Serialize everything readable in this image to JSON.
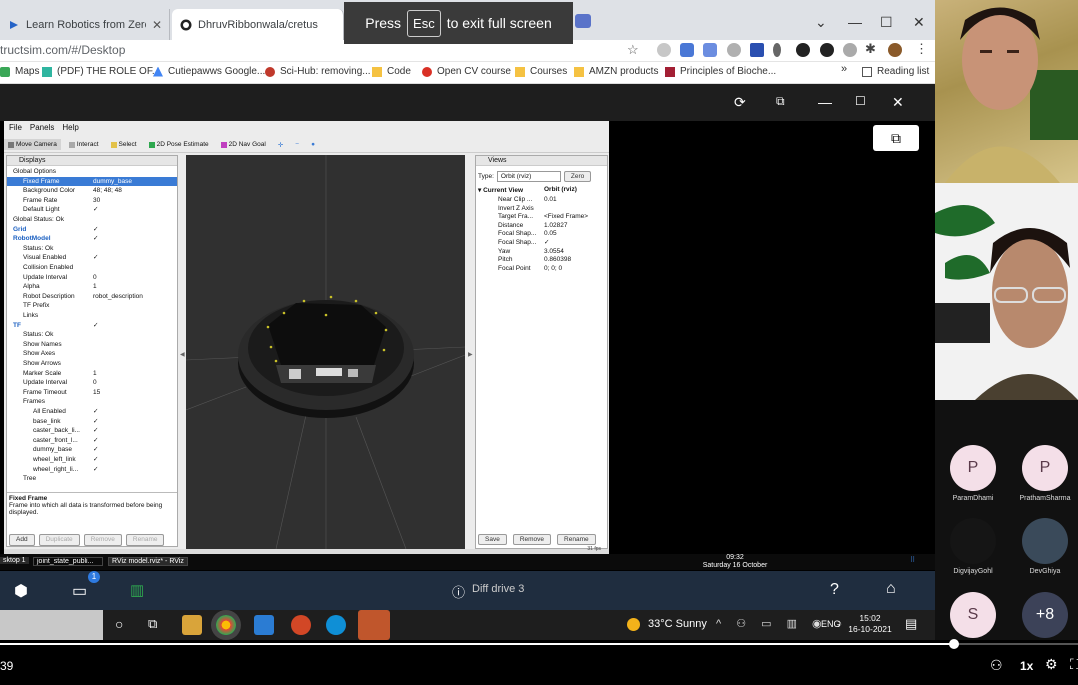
{
  "browser": {
    "tabs": [
      {
        "title": "Learn Robotics from Zero - Robc",
        "active": false
      },
      {
        "title": "DhruvRibbonwala/cretus: A basic",
        "active": true
      }
    ],
    "url": "tructsim.com/#/Desktop",
    "fullscreen_banner": {
      "press": "Press",
      "key": "Esc",
      "rest": "to exit full screen"
    },
    "bookmarks": [
      "Maps",
      "(PDF) THE ROLE OF...",
      "Cutiepawws Google...",
      "Sci-Hub: removing...",
      "Code",
      "Open CV course",
      "Courses",
      "AMZN products",
      "Principles of Bioche..."
    ],
    "bookmarks_more": "»",
    "reading_list": "Reading list"
  },
  "rviz": {
    "menu": [
      "File",
      "Panels",
      "Help"
    ],
    "tools": [
      "Move Camera",
      "Interact",
      "Select",
      "2D Pose Estimate",
      "2D Nav Goal"
    ],
    "displays": {
      "title": "Displays",
      "rows": [
        {
          "key": "Global Options",
          "val": "",
          "indent": 0,
          "icon": "gear"
        },
        {
          "key": "Fixed Frame",
          "val": "dummy_base",
          "indent": 1,
          "sel": true
        },
        {
          "key": "Background Color",
          "val": "48; 48; 48",
          "indent": 1
        },
        {
          "key": "Frame Rate",
          "val": "30",
          "indent": 1
        },
        {
          "key": "Default Light",
          "val": "✓",
          "indent": 1
        },
        {
          "key": "Global Status: Ok",
          "val": "",
          "indent": 0,
          "icon": "check"
        },
        {
          "key": "Grid",
          "val": "✓",
          "indent": 0,
          "icon": "grid",
          "blue": true
        },
        {
          "key": "RobotModel",
          "val": "✓",
          "indent": 0,
          "icon": "robot",
          "blue": true
        },
        {
          "key": "Status: Ok",
          "val": "",
          "indent": 1,
          "icon": "check"
        },
        {
          "key": "Visual Enabled",
          "val": "✓",
          "indent": 1
        },
        {
          "key": "Collision Enabled",
          "val": "",
          "indent": 1
        },
        {
          "key": "Update Interval",
          "val": "0",
          "indent": 1
        },
        {
          "key": "Alpha",
          "val": "1",
          "indent": 1
        },
        {
          "key": "Robot Description",
          "val": "robot_description",
          "indent": 1
        },
        {
          "key": "TF Prefix",
          "val": "",
          "indent": 1
        },
        {
          "key": "Links",
          "val": "",
          "indent": 1
        },
        {
          "key": "TF",
          "val": "✓",
          "indent": 0,
          "icon": "tf",
          "blue": true
        },
        {
          "key": "Status: Ok",
          "val": "",
          "indent": 1,
          "icon": "check"
        },
        {
          "key": "Show Names",
          "val": "",
          "indent": 1
        },
        {
          "key": "Show Axes",
          "val": "",
          "indent": 1
        },
        {
          "key": "Show Arrows",
          "val": "",
          "indent": 1
        },
        {
          "key": "Marker Scale",
          "val": "1",
          "indent": 1
        },
        {
          "key": "Update Interval",
          "val": "0",
          "indent": 1
        },
        {
          "key": "Frame Timeout",
          "val": "15",
          "indent": 1
        },
        {
          "key": "Frames",
          "val": "",
          "indent": 1
        },
        {
          "key": "All Enabled",
          "val": "✓",
          "indent": 2
        },
        {
          "key": "base_link",
          "val": "✓",
          "indent": 2
        },
        {
          "key": "caster_back_li...",
          "val": "✓",
          "indent": 2
        },
        {
          "key": "caster_front_l...",
          "val": "✓",
          "indent": 2
        },
        {
          "key": "dummy_base",
          "val": "✓",
          "indent": 2
        },
        {
          "key": "wheel_left_link",
          "val": "✓",
          "indent": 2
        },
        {
          "key": "wheel_right_li...",
          "val": "✓",
          "indent": 2
        },
        {
          "key": "Tree",
          "val": "",
          "indent": 1
        }
      ],
      "desc_title": "Fixed Frame",
      "desc_text": "Frame into which all data is transformed before being displayed.",
      "buttons": [
        "Add",
        "Duplicate",
        "Remove",
        "Rename"
      ]
    },
    "views": {
      "title": "Views",
      "type_label": "Type:",
      "type_value": "Orbit (rviz)",
      "zero": "Zero",
      "current_view": "Current View",
      "current_type": "Orbit (rviz)",
      "rows": [
        {
          "key": "Near Clip ...",
          "val": "0.01"
        },
        {
          "key": "Invert Z Axis",
          "val": ""
        },
        {
          "key": "Target Fra...",
          "val": "<Fixed Frame>"
        },
        {
          "key": "Distance",
          "val": "1.02827"
        },
        {
          "key": "Focal Shap...",
          "val": "0.05"
        },
        {
          "key": "Focal Shap...",
          "val": "✓"
        },
        {
          "key": "Yaw",
          "val": "3.0554"
        },
        {
          "key": "Pitch",
          "val": "0.860398"
        },
        {
          "key": "Focal Point",
          "val": "0; 0; 0"
        }
      ],
      "buttons": [
        "Save",
        "Remove",
        "Rename"
      ]
    },
    "fps": "31 fps"
  },
  "desktop_taskbar": {
    "items": [
      "sktop 1",
      "joint_state_publi...",
      "RViz model.rviz* - RViz"
    ],
    "time": "09:32",
    "date": "Saturday 16 October"
  },
  "app_bar": {
    "title": "Diff drive 3",
    "badge": "1"
  },
  "win_taskbar": {
    "weather": "33°C  Sunny",
    "lang": "ENG",
    "time": "15:02",
    "date": "16-10-2021"
  },
  "participants": [
    {
      "initial": "P",
      "name": "ParamDhami",
      "color": "#f4dfe8",
      "text": "#5a3a4a"
    },
    {
      "initial": "P",
      "name": "PrathamSharma",
      "color": "#f4dfe8",
      "text": "#5a3a4a"
    },
    {
      "initial": "",
      "name": "DigvijayGohl",
      "color": "#151515",
      "text": "#fff"
    },
    {
      "initial": "",
      "name": "DevGhiya",
      "color": "#3a4a5a",
      "text": "#fff"
    },
    {
      "initial": "S",
      "name": "",
      "color": "#f4dfe8",
      "text": "#5a3a4a"
    },
    {
      "initial": "+8",
      "name": "",
      "color": "#3c4258",
      "text": "#fff"
    }
  ],
  "player": {
    "time_left": "39",
    "speed": "1x",
    "progress": 0.885
  }
}
